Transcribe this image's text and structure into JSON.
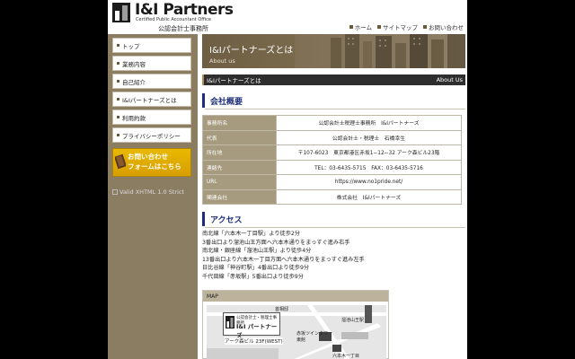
{
  "header": {
    "logo_name": "I&I Partners",
    "logo_tagline": "Certified Public Accountant Office",
    "logo_jp": "公認会計士事務所",
    "links": [
      {
        "label": "ホーム"
      },
      {
        "label": "サイトマップ"
      },
      {
        "label": "お問い合わせ"
      }
    ]
  },
  "sidebar": {
    "items": [
      {
        "label": "トップ"
      },
      {
        "label": "業務内容"
      },
      {
        "label": "自己紹介"
      },
      {
        "label": "I&Iパートナーズとは"
      },
      {
        "label": "利用約款"
      },
      {
        "label": "プライバシーポリシー"
      }
    ],
    "contact_line1": "お問い合わせ",
    "contact_line2": "フォームはこちら",
    "xhtml_alt": "Valid XHTML 1.0 Strict"
  },
  "main": {
    "hero_title": "I&Iパートナーズとは",
    "hero_sub": "About us",
    "section_title": "I&Iパートナーズとは",
    "section_en": "About Us",
    "company_heading": "会社概要",
    "company_rows": [
      {
        "label": "事務所名",
        "value": "公認会計士税理士事務所　I&Iパートナーズ"
      },
      {
        "label": "代表",
        "value": "公認会計士・税理士　石橋幸生"
      },
      {
        "label": "所在地",
        "value": "〒107-6023　東京都港区赤坂1−12−32 アーク森ビル23階"
      },
      {
        "label": "連絡先",
        "value": "TEL：03-6435-5715　FAX：03-6435-5716"
      },
      {
        "label": "URL",
        "value": "https://www.no1pride.net/"
      },
      {
        "label": "関連会社",
        "value": "株式会社　I&Iパートナーズ"
      }
    ],
    "access_heading": "アクセス",
    "access_lines": [
      "南北線「六本木一丁目駅」より徒歩2分",
      "3番出口より溜池山王方面へ六本木通りをまっすぐ進み右手",
      "南北線・銀座線「溜池山王駅」より徒歩4分",
      "13番出口より六本木一丁目方面へ六本木通りをまっすぐ進み左手",
      "日比谷線「神谷町駅」4番出口より徒歩9分",
      "千代田線「赤坂駅」5番出口より徒歩9分"
    ],
    "map_label": "MAP",
    "map": {
      "card_line1": "公認会計士・税理士事務所",
      "card_line2": "I&I パートナーズ",
      "card_line3": "アーク森ビル 23F(WEST)",
      "label_keio": "首相邸",
      "label_tameike": "溜池山王駅",
      "label_akasaka": "赤坂ツインタワー",
      "label_akasaka2": "東館",
      "label_roppongi": "六本木一丁目"
    }
  }
}
